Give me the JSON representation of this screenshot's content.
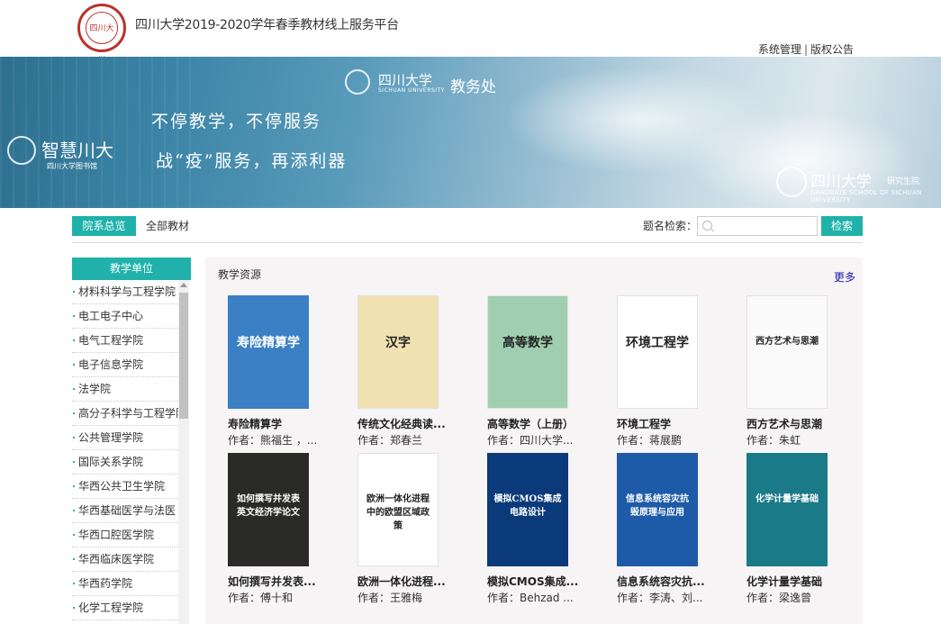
{
  "header": {
    "logo_text": "四川大学",
    "site_title": "四川大学2019-2020学年春季教材线上服务平台",
    "links": [
      "系统管理",
      "版权公告"
    ],
    "separator": "|"
  },
  "banner": {
    "smart_scu": "智慧川大",
    "smart_scu_sub": "四川大学图书馆",
    "scu_name": "四川大学",
    "scu_en": "SICHUAN UNIVERSITY",
    "office": "教务处",
    "slogan1": "不停教学，不停服务",
    "slogan2": "战“疫”服务，再添利器",
    "grad_name": "四川大学",
    "grad_sub": "研究生院",
    "grad_en": "GRADUATE SCHOOL OF SICHUAN UNIVERSITY"
  },
  "filter": {
    "tab_active": "院系总览",
    "tab_all": "全部教材",
    "search_label": "题名检索：",
    "search_value": "",
    "search_button": "检索"
  },
  "sidebar": {
    "title": "教学单位",
    "items": [
      "材料科学与工程学院",
      "电工电子中心",
      "电气工程学院",
      "电子信息学院",
      "法学院",
      "高分子科学与工程学院",
      "公共管理学院",
      "国际关系学院",
      "华西公共卫生学院",
      "华西基础医学与法医",
      "华西口腔医学院",
      "华西临床医学院",
      "华西药学院",
      "化学工程学院"
    ]
  },
  "panel": {
    "title": "教学资源",
    "more": "更多",
    "books": [
      {
        "title": "寿险精算学",
        "author": "作者：熊福生 ，...",
        "cover_text": "寿险精算学",
        "cover_color": "#3b7fc4"
      },
      {
        "title": "传统文化经典读...",
        "author": "作者：郑春兰",
        "cover_text": "汉字",
        "cover_color": "#efe2b0"
      },
      {
        "title": "高等数学（上册）",
        "author": "作者：四川大学...",
        "cover_text": "高等数学",
        "cover_color": "#9fcfb0"
      },
      {
        "title": "环境工程学",
        "author": "作者：蒋展鹏",
        "cover_text": "环境工程学",
        "cover_color": "#ffffff"
      },
      {
        "title": "西方艺术与思潮",
        "author": "作者：朱虹",
        "cover_text": "西方艺术与思潮",
        "cover_color": "#fafafa"
      },
      {
        "title": "如何撰写并发表...",
        "author": "作者：傅十和",
        "cover_text": "如何撰写并发表英文经济学论文",
        "cover_color": "#2a2a28"
      },
      {
        "title": "欧洲一体化进程...",
        "author": "作者：王雅梅",
        "cover_text": "欧洲一体化进程中的欧盟区域政策",
        "cover_color": "#ffffff"
      },
      {
        "title": "模拟CMOS集成...",
        "author": "作者：Behzad ...",
        "cover_text": "模拟CMOS集成电路设计",
        "cover_color": "#0a3a7a"
      },
      {
        "title": "信息系统容灾抗...",
        "author": "作者：李涛、刘...",
        "cover_text": "信息系统容灾抗毁原理与应用",
        "cover_color": "#1d5aa8"
      },
      {
        "title": "化学计量学基础",
        "author": "作者：梁逸曾",
        "cover_text": "化学计量学基础",
        "cover_color": "#1a7a88"
      }
    ]
  }
}
